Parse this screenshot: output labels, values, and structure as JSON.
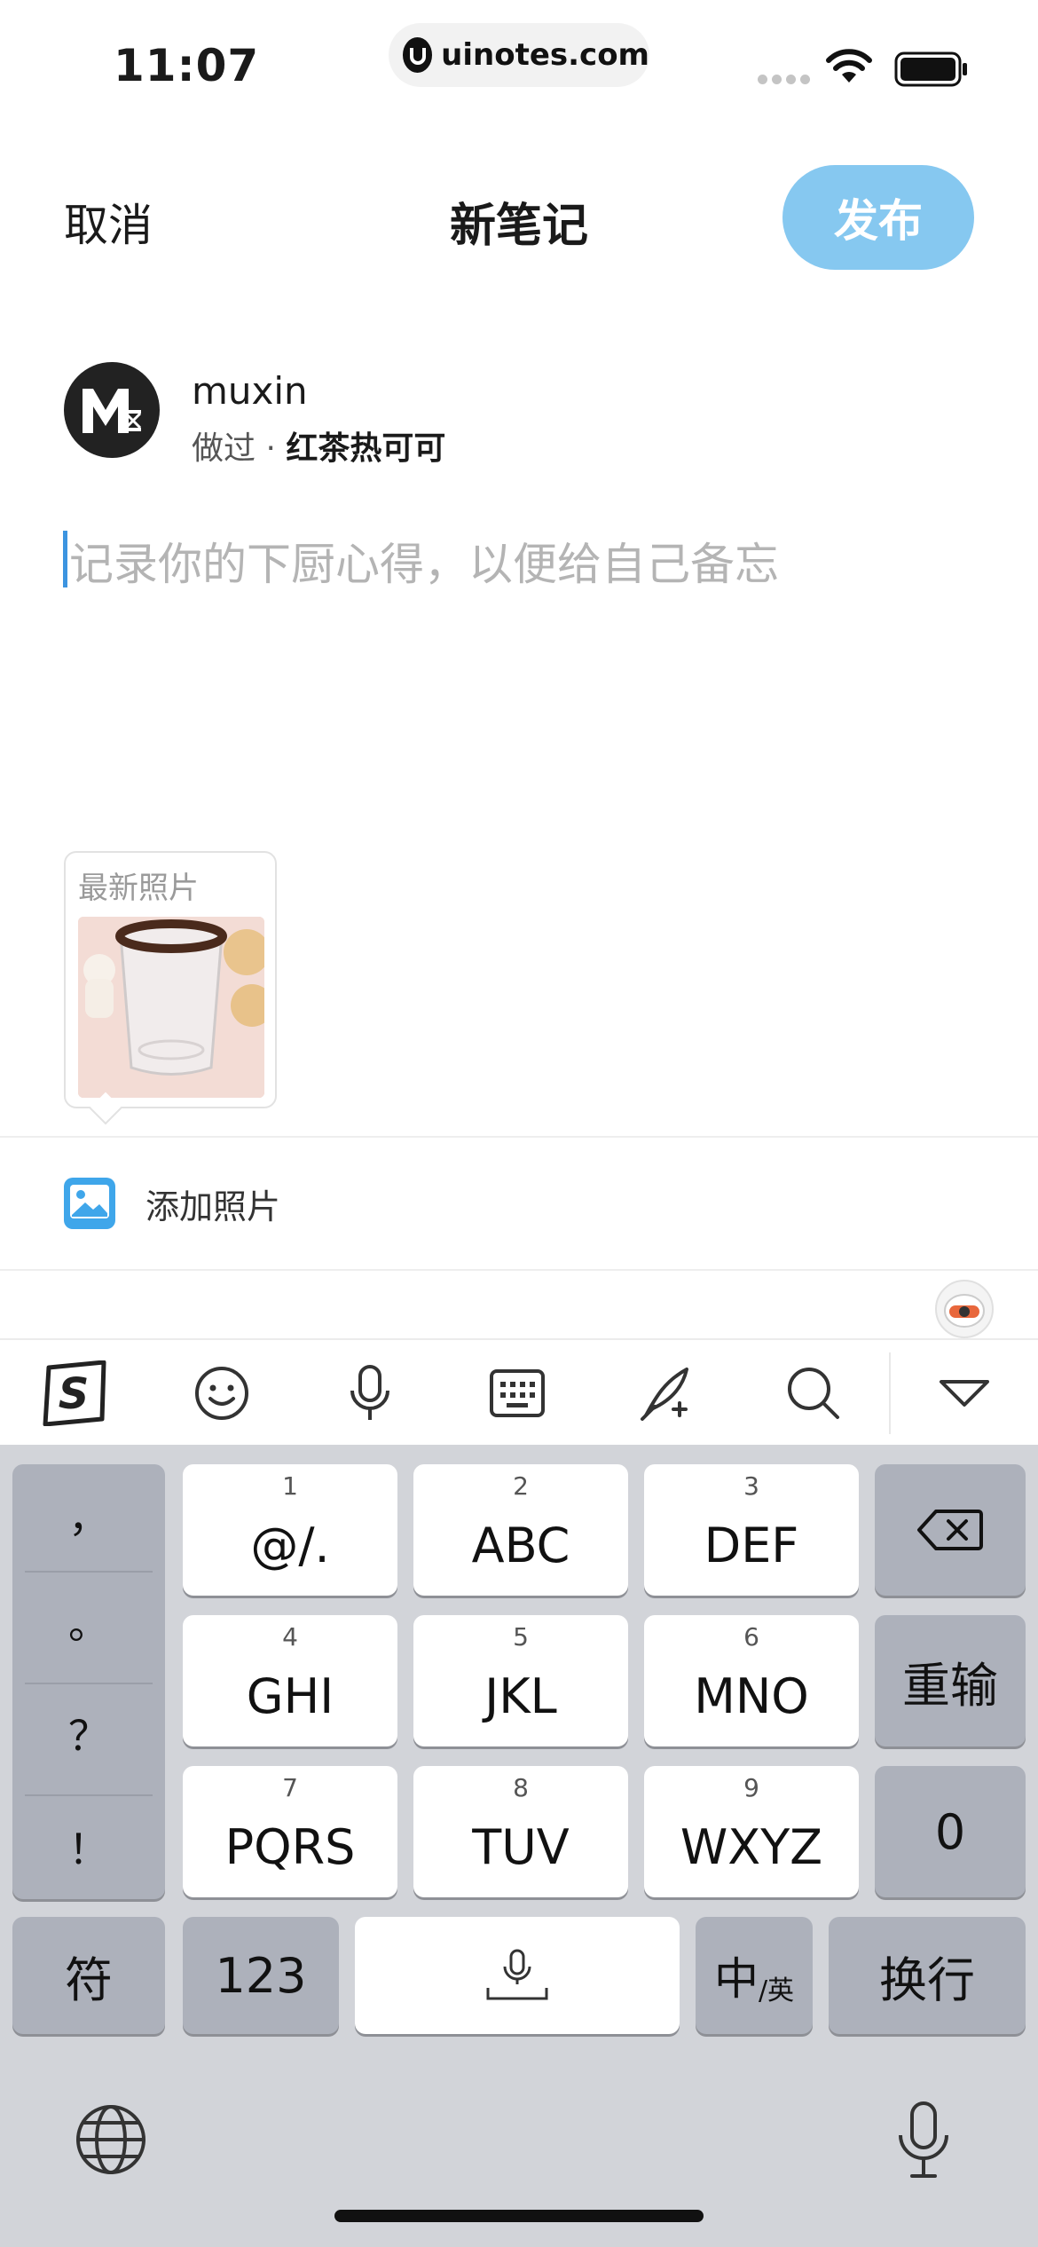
{
  "status_bar": {
    "time": "11:07",
    "url": "uinotes.com",
    "icons": [
      "signal-dots-icon",
      "wifi-icon",
      "battery-icon"
    ]
  },
  "nav": {
    "cancel_label": "取消",
    "title": "新笔记",
    "publish_label": "发布"
  },
  "colors": {
    "publish_button": "#86c8f0",
    "cursor": "#3c94e0",
    "keyboard_bg": "#d2d4d9",
    "key_dark": "#adb1bb"
  },
  "user": {
    "username": "muxin",
    "made_prefix": "做过 · ",
    "recipe_name": "红茶热可可"
  },
  "editor": {
    "placeholder": "记录你的下厨心得，以便给自己备忘",
    "value": ""
  },
  "latest_photo": {
    "label": "最新照片"
  },
  "add_photo": {
    "label": "添加照片",
    "icon": "image-icon"
  },
  "keyboard_toolbar": {
    "items": [
      "sogou-logo-icon",
      "emoji-icon",
      "microphone-icon",
      "keyboard-icon",
      "handwriting-icon",
      "search-icon",
      "collapse-keyboard-icon"
    ]
  },
  "keyboard": {
    "punctuation": [
      "，",
      "。",
      "？",
      "！"
    ],
    "keys": [
      {
        "num": "1",
        "letters": "@/."
      },
      {
        "num": "2",
        "letters": "ABC"
      },
      {
        "num": "3",
        "letters": "DEF"
      },
      {
        "num": "4",
        "letters": "GHI"
      },
      {
        "num": "5",
        "letters": "JKL"
      },
      {
        "num": "6",
        "letters": "MNO"
      },
      {
        "num": "7",
        "letters": "PQRS"
      },
      {
        "num": "8",
        "letters": "TUV"
      },
      {
        "num": "9",
        "letters": "WXYZ"
      }
    ],
    "reinput_label": "重输",
    "zero_label": "0",
    "symbol_label": "符",
    "number_label": "123",
    "lang_main": "中",
    "lang_sub": "/英",
    "return_label": "换行"
  }
}
